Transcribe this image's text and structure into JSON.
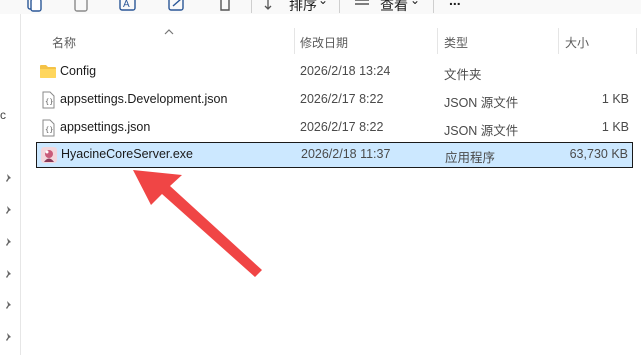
{
  "toolbar": {
    "sort_label": "排序",
    "view_label": "查看",
    "more_label": "..."
  },
  "nav": {
    "fragment_text": "c"
  },
  "columns": {
    "name": "名称",
    "date": "修改日期",
    "type": "类型",
    "size": "大小"
  },
  "files": [
    {
      "name": "Config",
      "date": "2026/2/18 13:24",
      "type": "文件夹",
      "size": "",
      "icon": "folder-icon"
    },
    {
      "name": "appsettings.Development.json",
      "date": "2026/2/17 8:22",
      "type": "JSON 源文件",
      "size": "1 KB",
      "icon": "json-file-icon"
    },
    {
      "name": "appsettings.json",
      "date": "2026/2/17 8:22",
      "type": "JSON 源文件",
      "size": "1 KB",
      "icon": "json-file-icon"
    },
    {
      "name": "HyacineCoreServer.exe",
      "date": "2026/2/18 11:37",
      "type": "应用程序",
      "size": "63,730 KB",
      "icon": "exe-app-icon",
      "selected": true
    }
  ],
  "colors": {
    "selection_bg": "#cce8ff",
    "annotation_arrow": "#f04545",
    "folder": "#f4c246"
  }
}
